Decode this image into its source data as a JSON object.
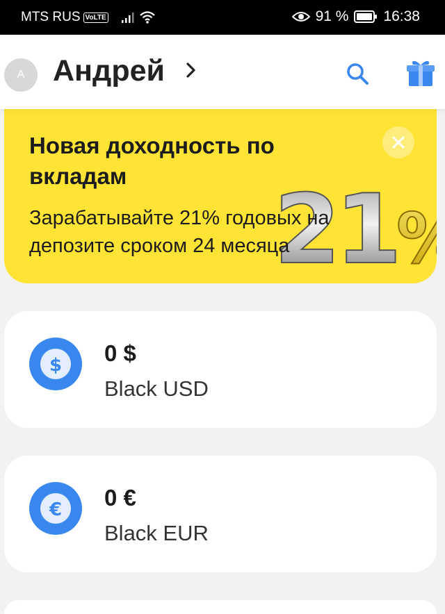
{
  "status_bar": {
    "carrier": "MTS RUS",
    "volte": "VoLTE",
    "battery_percent": "91 %",
    "time": "16:38"
  },
  "header": {
    "avatar_initial": "A",
    "user_name": "Андрей"
  },
  "promo": {
    "title": "Новая доходность по вкладам",
    "subtitle": "Зарабатывайте 21% годовых на депозите сроком 24 месяца",
    "art_text": "21%"
  },
  "accounts": [
    {
      "balance": "0 $",
      "name": "Black USD",
      "icon": "dollar-icon",
      "symbol": "$"
    },
    {
      "balance": "0 €",
      "name": "Black EUR",
      "icon": "euro-icon",
      "symbol": "€"
    }
  ],
  "colors": {
    "accent": "#3a87f0",
    "promo_background": "#ffe435",
    "page_background": "#f2f2f2"
  }
}
